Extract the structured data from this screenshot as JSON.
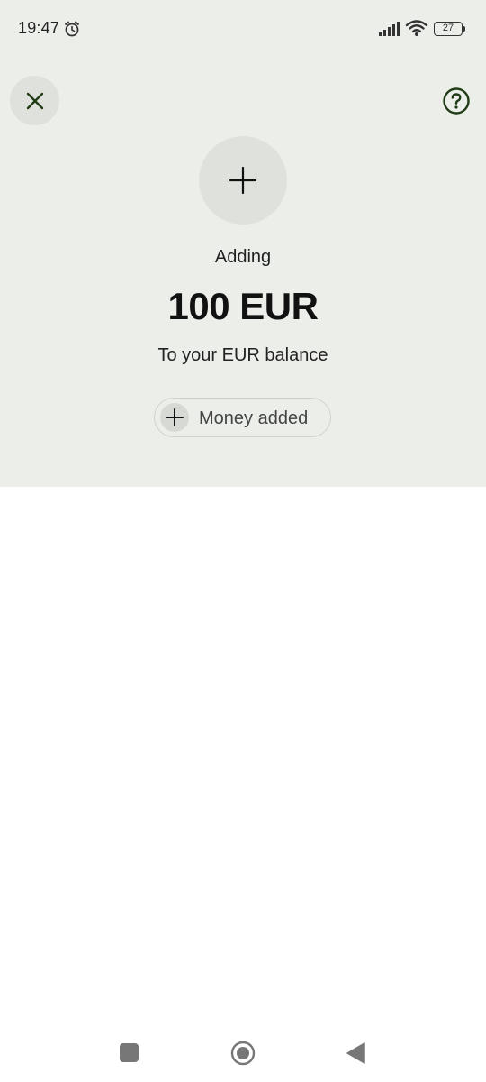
{
  "status_bar": {
    "time": "19:47",
    "battery_level": "27",
    "icons": [
      "alarm-icon",
      "signal-icon",
      "wifi-icon",
      "battery-icon"
    ]
  },
  "header": {
    "close_icon": "close-icon",
    "help_icon": "help-icon"
  },
  "main": {
    "icon": "plus-icon",
    "label": "Adding",
    "amount": "100 EUR",
    "subtitle": "To your EUR balance",
    "status_pill": {
      "icon": "plus-icon",
      "label": "Money added"
    }
  },
  "nav_bar": {
    "buttons": [
      "recents-button",
      "home-button",
      "back-button"
    ]
  },
  "colors": {
    "panel_background": "#eceeea",
    "circle_background": "#dfe1dc",
    "accent_dark_green": "#1f3b14",
    "text": "#111111"
  }
}
